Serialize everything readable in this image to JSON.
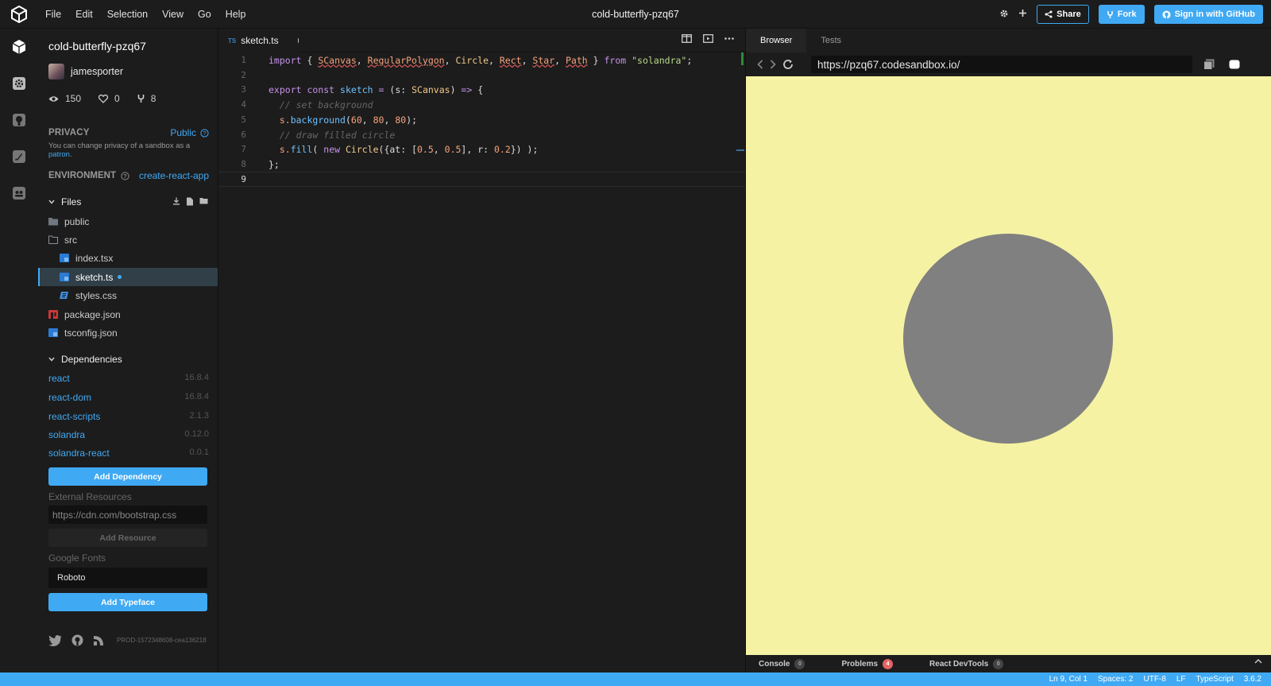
{
  "menubar": {
    "items": [
      "File",
      "Edit",
      "Selection",
      "View",
      "Go",
      "Help"
    ],
    "title": "cold-butterfly-pzq67",
    "share_label": "Share",
    "fork_label": "Fork",
    "signin_label": "Sign in with GitHub"
  },
  "activity_bar": {
    "icons": [
      "cube-icon",
      "settings-icon",
      "github-icon",
      "rocket-icon",
      "team-icon"
    ]
  },
  "sidebar": {
    "sandbox_name": "cold-butterfly-pzq67",
    "author": "jamesporter",
    "stats": {
      "views": "150",
      "likes": "0",
      "forks": "8"
    },
    "privacy_label": "PRIVACY",
    "privacy_value": "Public",
    "privacy_note": "You can change privacy of a sandbox as a",
    "privacy_link": "patron",
    "privacy_note_end": ".",
    "environment_label": "ENVIRONMENT",
    "environment_value": "create-react-app",
    "files_label": "Files",
    "files": [
      {
        "name": "public",
        "type": "folder",
        "depth": 0
      },
      {
        "name": "src",
        "type": "folder-open",
        "depth": 0
      },
      {
        "name": "index.tsx",
        "type": "tsx",
        "depth": 1
      },
      {
        "name": "sketch.ts",
        "type": "ts",
        "depth": 1,
        "active": true,
        "dirty": true
      },
      {
        "name": "styles.css",
        "type": "css",
        "depth": 1
      },
      {
        "name": "package.json",
        "type": "npm",
        "depth": 0
      },
      {
        "name": "tsconfig.json",
        "type": "tsjson",
        "depth": 0
      }
    ],
    "dependencies_label": "Dependencies",
    "dependencies": [
      {
        "name": "react",
        "version": "16.8.4"
      },
      {
        "name": "react-dom",
        "version": "16.8.4"
      },
      {
        "name": "react-scripts",
        "version": "2.1.3"
      },
      {
        "name": "solandra",
        "version": "0.12.0"
      },
      {
        "name": "solandra-react",
        "version": "0.0.1"
      }
    ],
    "add_dependency_label": "Add Dependency",
    "external_resources_label": "External Resources",
    "external_resource_placeholder": "https://cdn.com/bootstrap.css",
    "add_resource_label": "Add Resource",
    "google_fonts_label": "Google Fonts",
    "google_font_value": "Roboto",
    "add_typeface_label": "Add Typeface",
    "build_id": "PROD-1572348608-cea136218"
  },
  "editor": {
    "tab_badge": "TS",
    "tab_label": "sketch.ts",
    "line_numbers": [
      "1",
      "2",
      "3",
      "4",
      "5",
      "6",
      "7",
      "8",
      "9"
    ],
    "code": {
      "l1_a": "import",
      "l1_b": " { ",
      "l1_c": "SCanvas",
      "l1_d": ", ",
      "l1_e": "RegularPolygon",
      "l1_f": ", ",
      "l1_g": "Circle",
      "l1_h": ", ",
      "l1_i": "Rect",
      "l1_j": ", ",
      "l1_k": "Star",
      "l1_l": ", ",
      "l1_m": "Path",
      "l1_n": " } ",
      "l1_o": "from",
      "l1_p": " ",
      "l1_q": "\"solandra\"",
      "l1_r": ";",
      "l3_a": "export",
      "l3_b": " ",
      "l3_c": "const",
      "l3_d": " ",
      "l3_e": "sketch",
      "l3_f": " ",
      "l3_g": "=",
      "l3_h": " (s: ",
      "l3_i": "SCanvas",
      "l3_j": ") ",
      "l3_k": "=>",
      "l3_l": " {",
      "l4": "  // set background",
      "l5_a": "  s.",
      "l5_b": "background",
      "l5_c": "(",
      "l5_d": "60",
      "l5_e": ", ",
      "l5_f": "80",
      "l5_g": ", ",
      "l5_h": "80",
      "l5_i": ");",
      "l6": "  // draw filled circle",
      "l7_a": "  s.",
      "l7_b": "fill",
      "l7_c": "( ",
      "l7_d": "new",
      "l7_e": " ",
      "l7_f": "Circle",
      "l7_g": "({at: [",
      "l7_h": "0.5",
      "l7_i": ", ",
      "l7_j": "0.5",
      "l7_k": "], r: ",
      "l7_l": "0.2",
      "l7_m": "}) );",
      "l8": "};"
    }
  },
  "browser": {
    "tabs": [
      "Browser",
      "Tests"
    ],
    "url": "https://pzq67.codesandbox.io/",
    "background_color": "#f5f3a3",
    "circle_color": "#808080",
    "devtools": {
      "console_label": "Console",
      "console_count": "0",
      "problems_label": "Problems",
      "problems_count": "4",
      "react_devtools_label": "React DevTools",
      "react_devtools_count": "0"
    }
  },
  "statusbar": {
    "position": "Ln 9, Col 1",
    "spaces": "Spaces: 2",
    "encoding": "UTF-8",
    "eol": "LF",
    "language": "TypeScript",
    "version": "3.6.2"
  },
  "colors": {
    "accent": "#40a9f3",
    "background": "#1c1c1c"
  }
}
